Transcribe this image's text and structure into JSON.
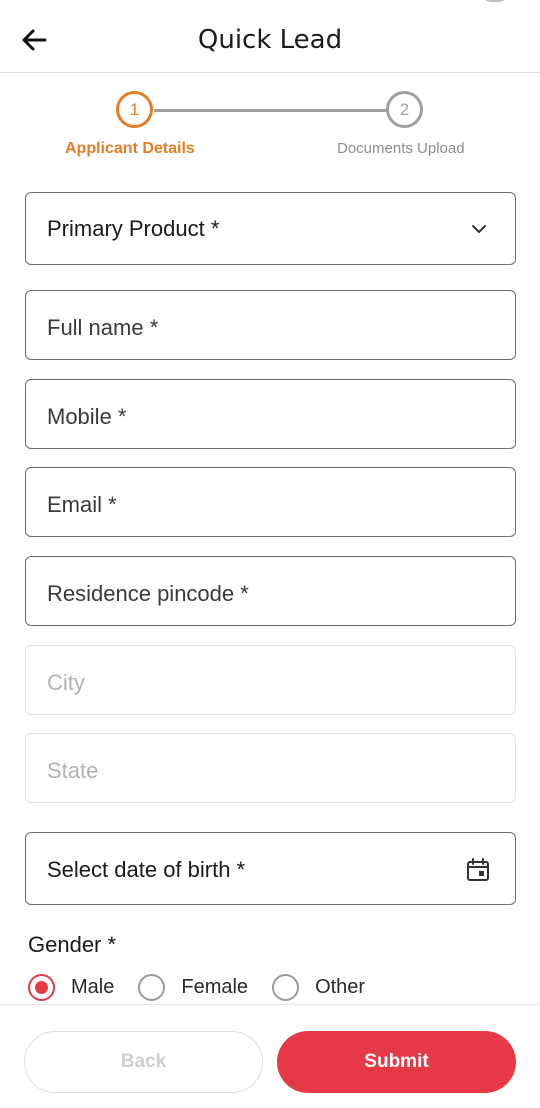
{
  "header": {
    "title": "Quick Lead",
    "back_icon": "arrow-left-icon"
  },
  "stepper": {
    "active_color": "#e87d25",
    "steps": [
      {
        "number": "1",
        "label": "Applicant Details",
        "state": "active"
      },
      {
        "number": "2",
        "label": "Documents Upload",
        "state": "pending"
      }
    ]
  },
  "form": {
    "primary_product": {
      "label": "Primary Product *",
      "icon": "chevron-down-icon"
    },
    "full_name": {
      "placeholder": "Full name *"
    },
    "mobile": {
      "placeholder": "Mobile *"
    },
    "email": {
      "placeholder": "Email *"
    },
    "pincode": {
      "placeholder": "Residence pincode *"
    },
    "city": {
      "placeholder": "City",
      "disabled": true
    },
    "state": {
      "placeholder": "State",
      "disabled": true
    },
    "dob": {
      "label": "Select date of birth *",
      "icon": "calendar-icon"
    },
    "gender": {
      "title": "Gender *",
      "selected": "Male",
      "options": [
        "Male",
        "Female",
        "Other"
      ]
    }
  },
  "footer": {
    "back_label": "Back",
    "submit_label": "Submit",
    "accent": "#e63946"
  }
}
